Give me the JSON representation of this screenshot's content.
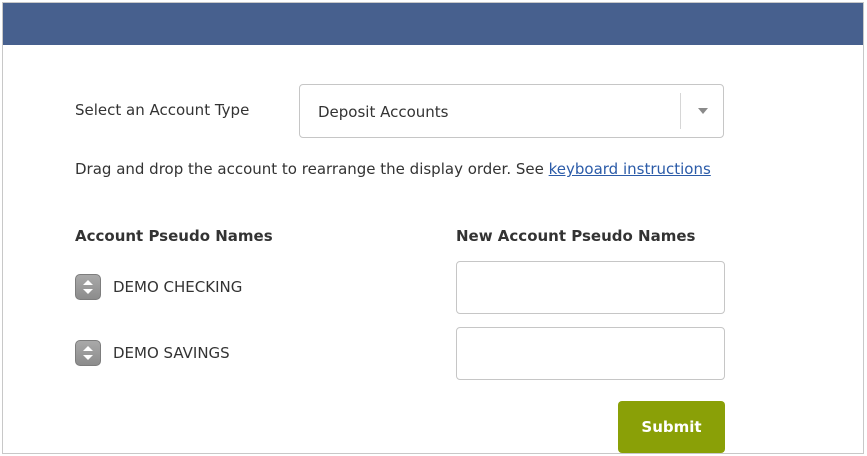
{
  "form": {
    "account_type_label": "Select an Account Type",
    "account_type_selected": "Deposit Accounts",
    "instructions_text": "Drag and drop the account to rearrange the display order. See ",
    "instructions_link": "keyboard instructions",
    "col_left_header": "Account Pseudo Names",
    "col_right_header": "New Account Pseudo Names",
    "accounts": [
      {
        "name": "DEMO CHECKING",
        "new_name": ""
      },
      {
        "name": "DEMO SAVINGS",
        "new_name": ""
      }
    ],
    "submit_label": "Submit"
  },
  "colors": {
    "header_bar": "#47608e",
    "submit_button": "#8aa007",
    "link": "#2b5ba8"
  },
  "icons": {
    "select_caret": "chevron-down-icon",
    "drag_handle": "drag-handle-icon"
  }
}
